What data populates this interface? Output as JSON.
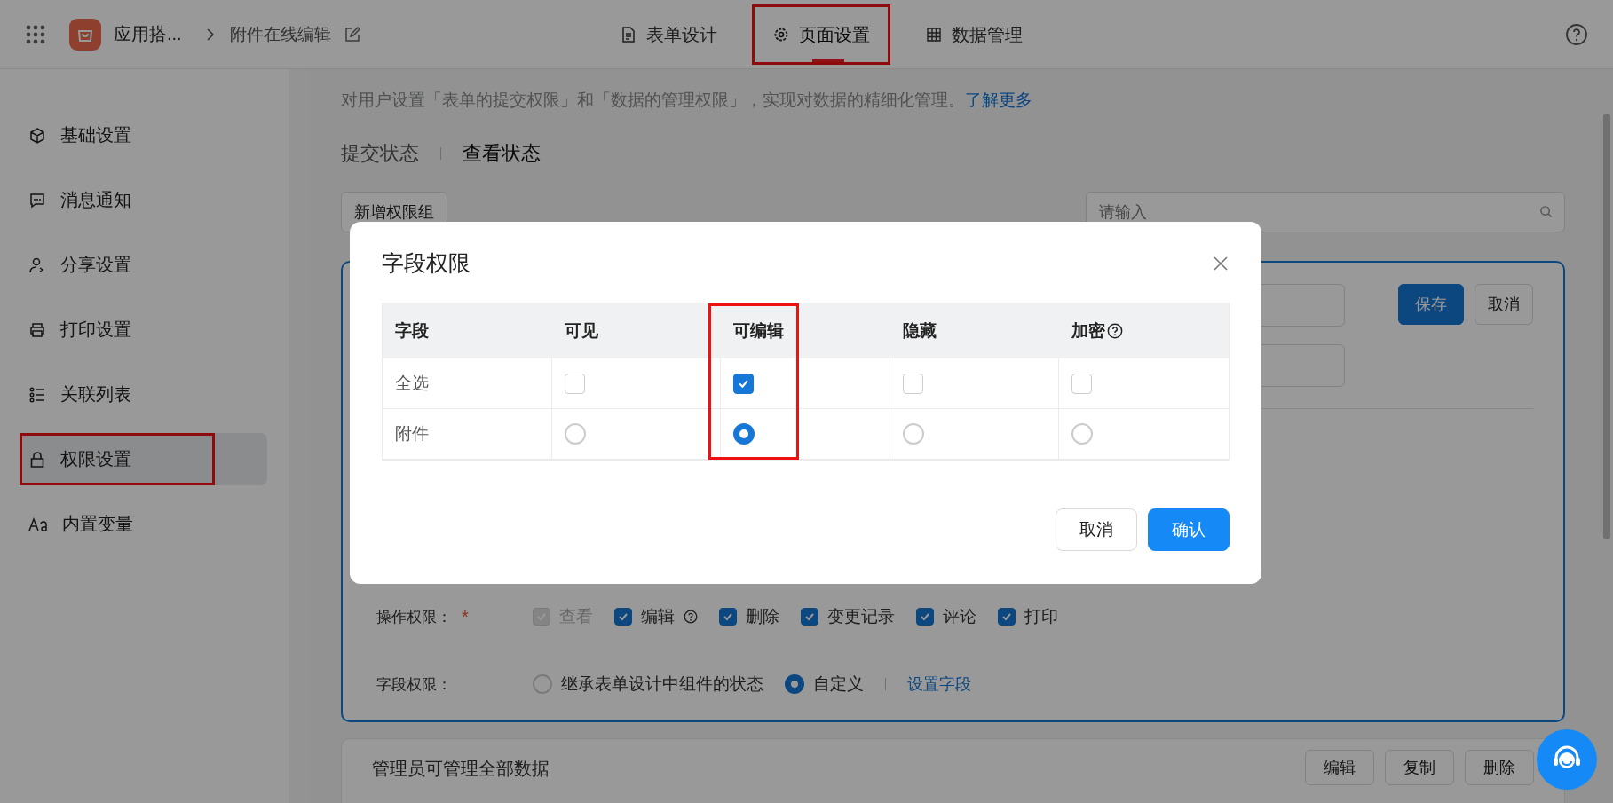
{
  "topbar": {
    "app_name": "应用搭...",
    "page_name": "附件在线编辑",
    "tabs": [
      {
        "label": "表单设计",
        "selected": false,
        "highlighted": false
      },
      {
        "label": "页面设置",
        "selected": true,
        "highlighted": true
      },
      {
        "label": "数据管理",
        "selected": false,
        "highlighted": false
      }
    ]
  },
  "sidebar": {
    "items": [
      {
        "label": "基础设置",
        "selected": false,
        "highlighted": false
      },
      {
        "label": "消息通知",
        "selected": false,
        "highlighted": false
      },
      {
        "label": "分享设置",
        "selected": false,
        "highlighted": false
      },
      {
        "label": "打印设置",
        "selected": false,
        "highlighted": false
      },
      {
        "label": "关联列表",
        "selected": false,
        "highlighted": false
      },
      {
        "label": "权限设置",
        "selected": true,
        "highlighted": true
      },
      {
        "label": "内置变量",
        "selected": false,
        "highlighted": false
      }
    ]
  },
  "main": {
    "description": "对用户设置「表单的提交权限」和「数据的管理权限」，实现对数据的精细化管理。",
    "learn_more": "了解更多",
    "tabs": [
      {
        "label": "提交状态",
        "selected": false
      },
      {
        "label": "查看状态",
        "selected": true
      }
    ],
    "add_button": "新增权限组",
    "search": {
      "placeholder": "请输入"
    },
    "group_card": {
      "save": "保存",
      "cancel": "取消",
      "operation": {
        "label": "操作权限：",
        "required_mark": "*",
        "options": [
          {
            "label": "查看",
            "checked": true,
            "disabled": true,
            "help": false
          },
          {
            "label": "编辑",
            "checked": true,
            "disabled": false,
            "help": true
          },
          {
            "label": "删除",
            "checked": true,
            "disabled": false,
            "help": false
          },
          {
            "label": "变更记录",
            "checked": true,
            "disabled": false,
            "help": false
          },
          {
            "label": "评论",
            "checked": true,
            "disabled": false,
            "help": false
          },
          {
            "label": "打印",
            "checked": true,
            "disabled": false,
            "help": false
          }
        ]
      },
      "field": {
        "label": "字段权限：",
        "options": [
          {
            "label": "继承表单设计中组件的状态",
            "selected": false
          },
          {
            "label": "自定义",
            "selected": true
          }
        ],
        "link": "设置字段"
      }
    },
    "next_card": {
      "title": "管理员可管理全部数据",
      "buttons": [
        "编辑",
        "复制",
        "删除"
      ]
    }
  },
  "modal": {
    "title": "字段权限",
    "columns": [
      {
        "label": "字段",
        "help": false,
        "highlighted": false
      },
      {
        "label": "可见",
        "help": false,
        "highlighted": false
      },
      {
        "label": "可编辑",
        "help": false,
        "highlighted": true
      },
      {
        "label": "隐藏",
        "help": false,
        "highlighted": false
      },
      {
        "label": "加密",
        "help": true,
        "highlighted": false
      }
    ],
    "rows": [
      {
        "label": "全选",
        "kind": "checkbox",
        "cells": [
          {
            "checked": false
          },
          {
            "checked": true
          },
          {
            "checked": false
          },
          {
            "checked": false
          }
        ]
      },
      {
        "label": "附件",
        "kind": "radio",
        "cells": [
          {
            "selected": false
          },
          {
            "selected": true
          },
          {
            "selected": false
          },
          {
            "selected": false
          }
        ]
      }
    ],
    "cancel": "取消",
    "confirm": "确认"
  }
}
